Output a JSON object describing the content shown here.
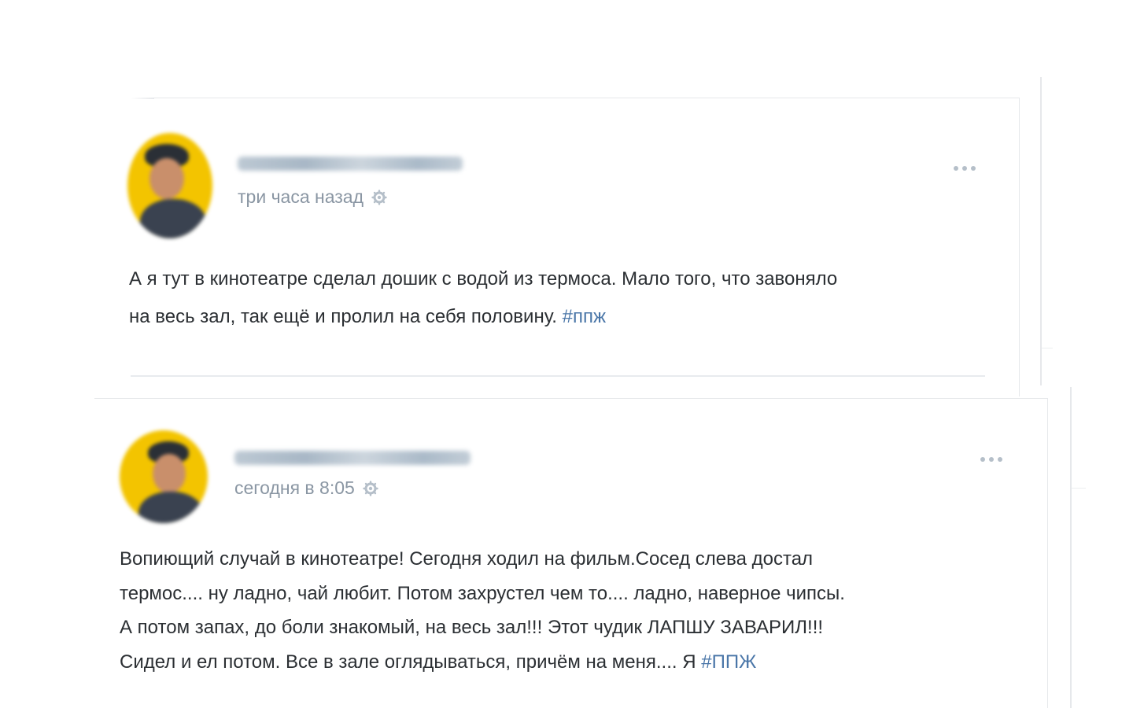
{
  "posts": [
    {
      "author_name": "",
      "timestamp": "три часа назад",
      "text_lines": [
        "А я тут в кинотеатре сделал дошик с водой из термоса. Мало того, что завоняло",
        "на весь зал, так ещё и пролил на себя половину. "
      ],
      "hashtag": "#ппж",
      "avatar_icon": "user-avatar-icon",
      "gear_icon": "gear-icon",
      "more_icon": "more-options-icon"
    },
    {
      "author_name": "",
      "timestamp": "сегодня в 8:05",
      "text_lines": [
        "Вопиющий случай в кинотеатре! Сегодня ходил на фильм.Сосед слева достал",
        "термос.... ну ладно, чай любит. Потом захрустел чем то.... ладно, наверное чипсы.",
        "А потом запах, до боли знакомый, на весь зал!!! Этот чудик ЛАПШУ ЗАВАРИЛ!!!",
        "Сидел и ел потом. Все в зале оглядываться, причём на меня.... Я "
      ],
      "hashtag": "#ППЖ",
      "avatar_icon": "user-avatar-icon",
      "gear_icon": "gear-icon",
      "more_icon": "more-options-icon"
    }
  ],
  "colors": {
    "text": "#2b2f33",
    "meta": "#8a96a3",
    "hashtag": "#4a76a8",
    "avatar_bg": "#f3c400",
    "border": "#e6e8eb"
  }
}
